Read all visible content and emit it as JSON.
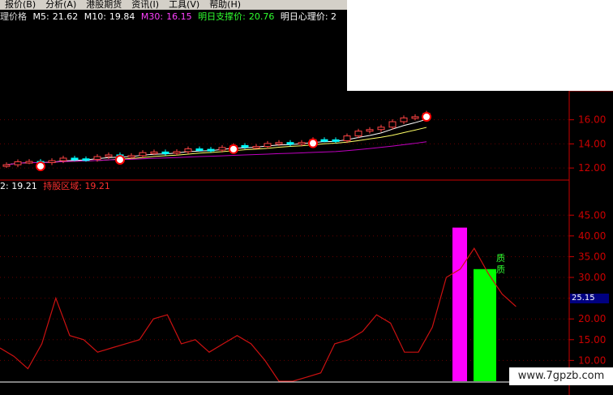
{
  "menubar": {
    "items": [
      "报价(B)",
      "分析(A)",
      "港股期货",
      "资讯(I)",
      "工具(V)",
      "帮助(H)"
    ]
  },
  "info": {
    "label": "理价格",
    "ma5_label": "M5:",
    "ma5": "21.62",
    "ma10_label": "M10:",
    "ma10": "19.84",
    "ma30_label": "M30:",
    "ma30": "16.15",
    "support_label": "明日支撑价:",
    "support": "20.76",
    "psych_label": "明日心理价: 2"
  },
  "price_axis": {
    "ticks": [
      "16.00",
      "14.00",
      "12.00"
    ],
    "values": [
      16,
      14,
      12
    ],
    "range": [
      11.0,
      18.4
    ]
  },
  "indicator": {
    "prefix": "2:",
    "value1": "19.21",
    "label2": "持股区域:",
    "value2": "19.21",
    "current_value": "25.15",
    "bar_labels": [
      "质",
      "质"
    ]
  },
  "indicator_axis": {
    "ticks": [
      "45.00",
      "40.00",
      "35.00",
      "30.00",
      "25.00",
      "20.00",
      "15.00",
      "10.00"
    ],
    "values": [
      45,
      40,
      35,
      30,
      25,
      20,
      15,
      10
    ],
    "range": [
      4.8,
      51.5
    ]
  },
  "indicator_line": [
    13,
    11,
    8,
    14,
    25,
    16,
    15,
    12,
    13,
    14,
    15,
    20,
    21,
    14,
    15,
    12,
    14,
    16,
    14,
    10,
    5,
    5,
    6,
    7,
    14,
    15,
    17,
    21,
    19,
    12,
    12,
    18,
    30,
    32,
    37,
    31,
    26,
    23
  ],
  "bars": [
    {
      "color": "#ff00ff",
      "from": 5,
      "to": 42
    },
    {
      "color": "#00ff00",
      "from": 5,
      "to": 32
    }
  ],
  "colors": {
    "axis_red": "#cc0000",
    "ma30": "#c000c0",
    "ind_line": "#cc1111",
    "info_red": "#ff3030",
    "info_green": "#30ff30",
    "info_magenta": "#ff40ff"
  },
  "watermark": "www.7gpzb.com"
}
